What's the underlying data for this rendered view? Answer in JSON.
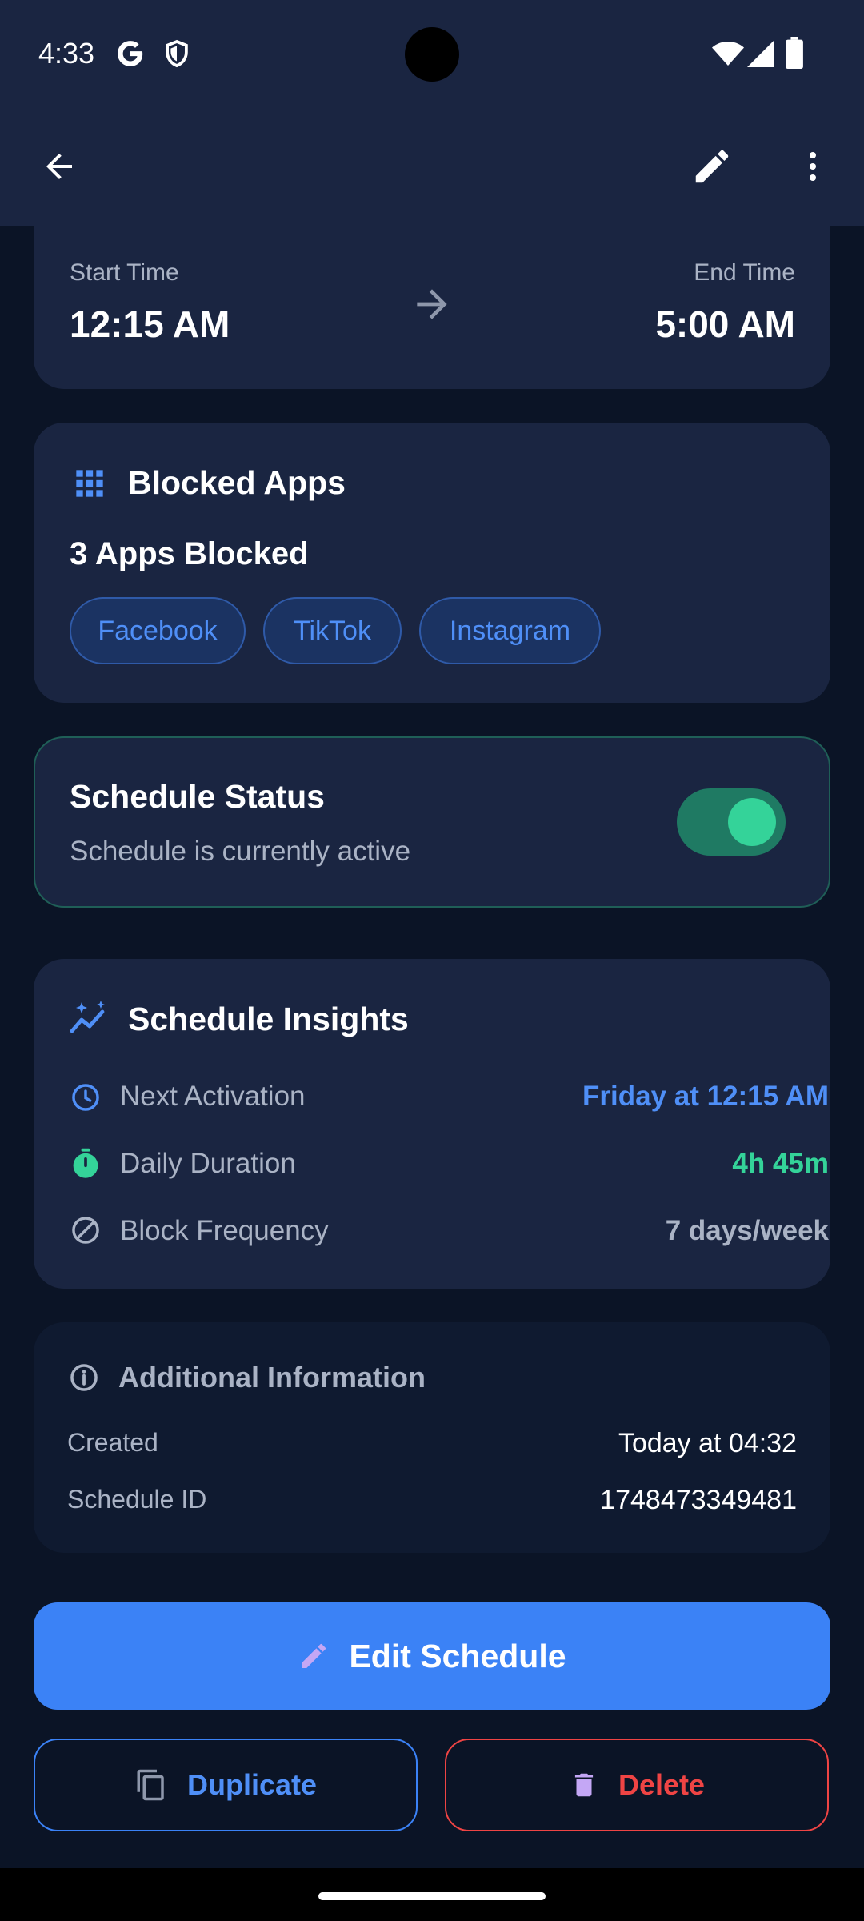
{
  "status_bar": {
    "time": "4:33",
    "icons": [
      "google-icon",
      "shield-icon",
      "wifi-icon",
      "signal-icon",
      "battery-icon"
    ]
  },
  "app_bar": {
    "icons": [
      "back-arrow-icon",
      "edit-icon",
      "more-vert-icon"
    ]
  },
  "time_card": {
    "start_label": "Start Time",
    "start_value": "12:15 AM",
    "end_label": "End Time",
    "end_value": "5:00 AM"
  },
  "blocked_apps": {
    "title": "Blocked Apps",
    "count_text": "3 Apps Blocked",
    "apps": [
      "Facebook",
      "TikTok",
      "Instagram"
    ]
  },
  "schedule_status": {
    "title": "Schedule Status",
    "subtitle": "Schedule is currently active",
    "toggle_on": true
  },
  "insights": {
    "title": "Schedule Insights",
    "rows": [
      {
        "label": "Next Activation",
        "value": "Friday at 12:15 AM",
        "color": "#4f8ff7"
      },
      {
        "label": "Daily Duration",
        "value": "4h 45m",
        "color": "#34d399"
      },
      {
        "label": "Block Frequency",
        "value": "7 days/week",
        "color": "#aab3c5"
      }
    ]
  },
  "additional": {
    "title": "Additional Information",
    "rows": [
      {
        "label": "Created",
        "value": "Today at 04:32"
      },
      {
        "label": "Schedule ID",
        "value": "1748473349481"
      }
    ]
  },
  "actions": {
    "edit_label": "Edit Schedule",
    "duplicate_label": "Duplicate",
    "delete_label": "Delete"
  },
  "colors": {
    "accent_blue": "#3b82f6",
    "accent_green": "#34d399",
    "danger_red": "#ef4444",
    "card_bg": "#1a2541",
    "page_bg": "#0b1426"
  }
}
